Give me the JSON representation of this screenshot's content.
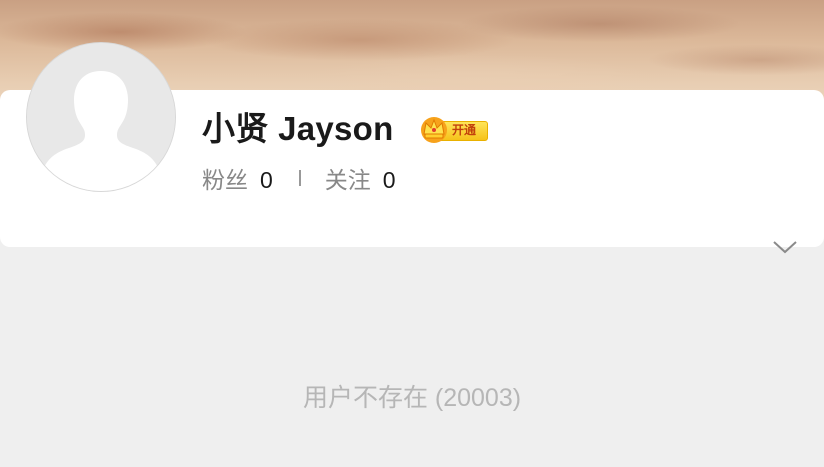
{
  "profile": {
    "username": "小贤 Jayson",
    "vip_badge": "开通",
    "followers_label": "粉丝",
    "followers_count": "0",
    "following_label": "关注",
    "following_count": "0"
  },
  "status_message": "用户不存在 (20003)",
  "colors": {
    "background": "#efefef",
    "card": "#ffffff",
    "vip_gold": "#f6c21a"
  }
}
